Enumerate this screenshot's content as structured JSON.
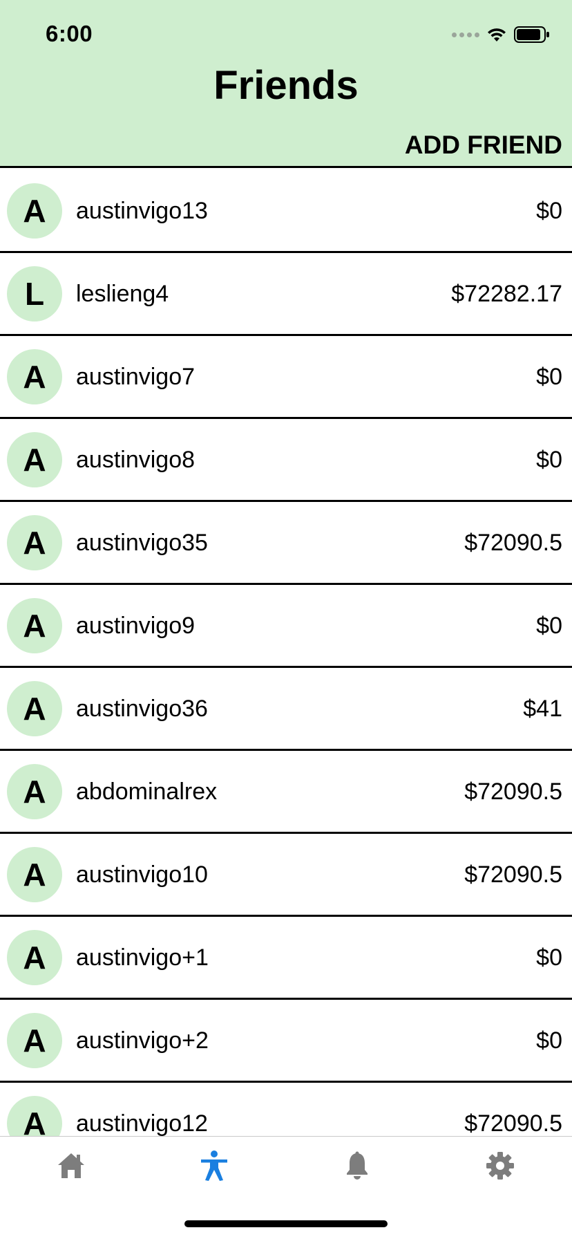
{
  "status_bar": {
    "time": "6:00"
  },
  "header": {
    "title": "Friends",
    "add_friend_label": "ADD FRIEND"
  },
  "friends": [
    {
      "initial": "A",
      "name": "austinvigo13",
      "amount": "$0"
    },
    {
      "initial": "L",
      "name": "leslieng4",
      "amount": "$72282.17"
    },
    {
      "initial": "A",
      "name": "austinvigo7",
      "amount": "$0"
    },
    {
      "initial": "A",
      "name": "austinvigo8",
      "amount": "$0"
    },
    {
      "initial": "A",
      "name": "austinvigo35",
      "amount": "$72090.5"
    },
    {
      "initial": "A",
      "name": "austinvigo9",
      "amount": "$0"
    },
    {
      "initial": "A",
      "name": "austinvigo36",
      "amount": "$41"
    },
    {
      "initial": "A",
      "name": "abdominalrex",
      "amount": "$72090.5"
    },
    {
      "initial": "A",
      "name": "austinvigo10",
      "amount": "$72090.5"
    },
    {
      "initial": "A",
      "name": "austinvigo+1",
      "amount": "$0"
    },
    {
      "initial": "A",
      "name": "austinvigo+2",
      "amount": "$0"
    },
    {
      "initial": "A",
      "name": "austinvigo12",
      "amount": "$72090.5"
    }
  ],
  "tab_bar": {
    "tabs": [
      {
        "icon": "home-icon",
        "active": false
      },
      {
        "icon": "accessibility-person-icon",
        "active": true
      },
      {
        "icon": "bell-icon",
        "active": false
      },
      {
        "icon": "gear-icon",
        "active": false
      }
    ],
    "active_color": "#1a7fe0",
    "inactive_color": "#7d7d7d"
  },
  "colors": {
    "header_bg": "#cfeecf",
    "avatar_bg": "#cfeecf"
  }
}
